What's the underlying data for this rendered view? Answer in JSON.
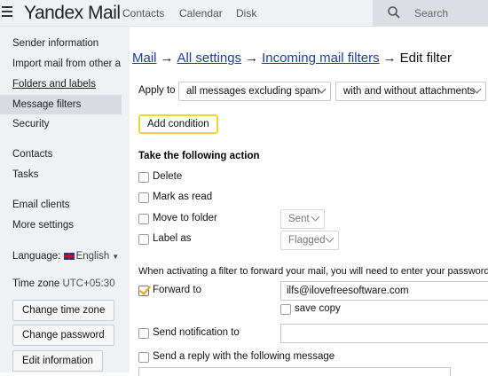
{
  "header": {
    "logo_brand": "Yandex",
    "logo_product": "Mail",
    "nav": [
      "Contacts",
      "Calendar",
      "Disk"
    ],
    "search_placeholder": "Search"
  },
  "sidebar": {
    "items": [
      {
        "label": "Sender information"
      },
      {
        "label": "Import mail from other a"
      },
      {
        "label": "Folders and labels"
      },
      {
        "label": "Message filters"
      },
      {
        "label": "Security"
      },
      {
        "label": "Contacts"
      },
      {
        "label": "Tasks"
      },
      {
        "label": "Email clients"
      },
      {
        "label": "More settings"
      }
    ],
    "language_label": "Language:",
    "language_value": "English",
    "timezone_label": "Time zone",
    "timezone_value": "UTC+05:30",
    "buttons": {
      "change_time_zone": "Change time zone",
      "change_password": "Change password",
      "edit_information": "Edit information"
    }
  },
  "breadcrumb": {
    "mail": "Mail",
    "all_settings": "All settings",
    "incoming_filters": "Incoming mail filters",
    "arrow": "→",
    "current": "Edit filter"
  },
  "filter": {
    "apply_to_label": "Apply to",
    "apply_to_value": "all messages excluding spam",
    "attachments_value": "with and without attachments",
    "add_condition": "Add condition",
    "actions_title": "Take the following action",
    "actions": {
      "delete": "Delete",
      "mark_read": "Mark as read",
      "move_to_folder": "Move to folder",
      "move_folder_value": "Sent",
      "label_as": "Label as",
      "label_value": "Flagged"
    },
    "forward_note": "When activating a filter to forward your mail, you will need to enter your password",
    "forward_to_label": "Forward to",
    "forward_to_value": "ilfs@ilovefreesoftware.com",
    "save_copy": "save copy",
    "send_notification": "Send notification to",
    "send_reply": "Send a reply with the following message"
  },
  "colors": {
    "accent_yellow": "#f5d33b",
    "link_blue": "#1a3fa0",
    "sidebar_bg": "#f0f1f4"
  }
}
